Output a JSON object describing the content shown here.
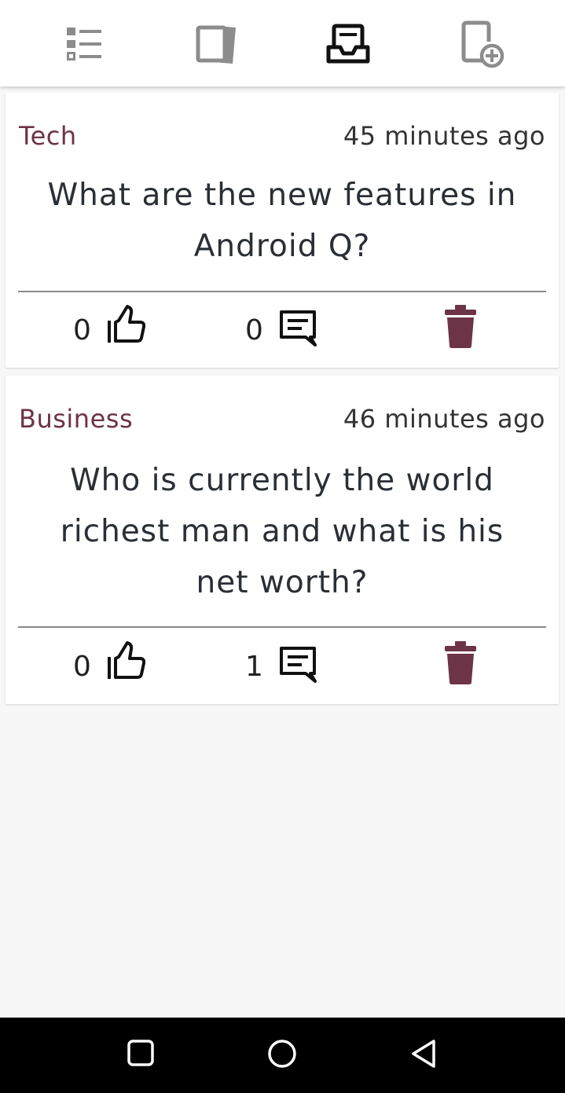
{
  "tabs": [
    {
      "name": "list-icon",
      "active": false
    },
    {
      "name": "cards-icon",
      "active": false
    },
    {
      "name": "inbox-icon",
      "active": true
    },
    {
      "name": "add-document-icon",
      "active": false
    }
  ],
  "posts": [
    {
      "category": "Tech",
      "time": "45 minutes ago",
      "question": "What are the new features in Android Q?",
      "likes": "0",
      "comments": "0"
    },
    {
      "category": "Business",
      "time": "46 minutes ago",
      "question": "Who is currently the world richest man and what is his net worth?",
      "likes": "0",
      "comments": "1"
    }
  ],
  "colors": {
    "accent": "#6d3346",
    "icon_inactive": "#8c8c8c",
    "icon_active": "#111111"
  },
  "navbar": [
    "recent-apps-icon",
    "home-icon",
    "back-icon"
  ]
}
